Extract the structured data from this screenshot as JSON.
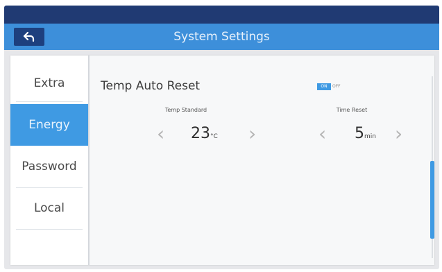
{
  "header": {
    "title": "System Settings",
    "back_icon": "back-arrow-icon",
    "color": "#3d8fda",
    "topbar_color": "#203a73"
  },
  "sidebar": {
    "items": [
      {
        "label": "Extra",
        "active": false
      },
      {
        "label": "Energy",
        "active": true
      },
      {
        "label": "Password",
        "active": false
      },
      {
        "label": "Local",
        "active": false
      }
    ],
    "active_color": "#3f9ae3"
  },
  "main": {
    "section_title": "Temp Auto Reset",
    "toggle": {
      "on_label": "ON",
      "off_label": "OFF",
      "state": "on"
    },
    "temp": {
      "label": "Temp Standard",
      "value": "23",
      "unit": "°C"
    },
    "time": {
      "label": "Time Reset",
      "value": "5",
      "unit": "min"
    },
    "prev_icon": "chevron-left-icon",
    "next_icon": "chevron-right-icon"
  }
}
